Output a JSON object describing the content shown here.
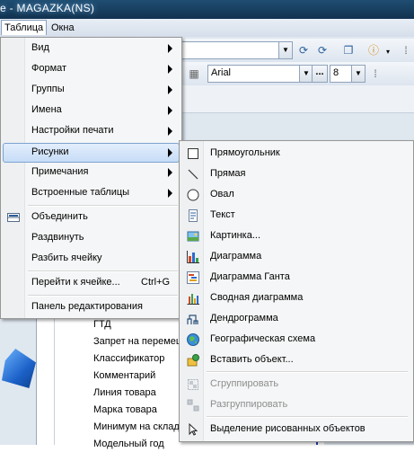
{
  "window": {
    "title": "e - MAGAZKA(NS)"
  },
  "menubar": {
    "items": [
      "Таблица",
      "Окна"
    ]
  },
  "toolbar": {
    "font_name": "Arial",
    "font_size": "8",
    "more_button": "..."
  },
  "document": {
    "header": "ГТД",
    "lines": [
      "Запрет на перемещ",
      "Классификатор",
      "Комментарий",
      "Линия товара",
      "Марка товара",
      "Минимум на складе",
      "Модельный год"
    ]
  },
  "table_menu": {
    "items": [
      {
        "label": "Вид",
        "submenu": true
      },
      {
        "label": "Формат",
        "submenu": true
      },
      {
        "label": "Группы",
        "submenu": true
      },
      {
        "label": "Имена",
        "submenu": true
      },
      {
        "label": "Настройки печати",
        "submenu": true
      },
      {
        "label": "Рисунки",
        "submenu": true,
        "highlighted": true
      },
      {
        "label": "Примечания",
        "submenu": true
      },
      {
        "label": "Встроенные таблицы",
        "submenu": true
      },
      {
        "label": "Объединить",
        "icon": "merge-cells-icon"
      },
      {
        "label": "Раздвинуть"
      },
      {
        "label": "Разбить ячейку"
      },
      {
        "label": "Перейти к ячейке...",
        "shortcut": "Ctrl+G"
      },
      {
        "label": "Панель редактирования"
      }
    ]
  },
  "pictures_submenu": {
    "items": [
      {
        "label": "Прямоугольник",
        "icon": "rectangle-icon"
      },
      {
        "label": "Прямая",
        "icon": "line-icon"
      },
      {
        "label": "Овал",
        "icon": "oval-icon"
      },
      {
        "label": "Текст",
        "icon": "text-icon"
      },
      {
        "label": "Картинка...",
        "icon": "picture-icon"
      },
      {
        "label": "Диаграмма",
        "icon": "chart-icon"
      },
      {
        "label": "Диаграмма Ганта",
        "icon": "gantt-chart-icon"
      },
      {
        "label": "Сводная диаграмма",
        "icon": "pivot-chart-icon"
      },
      {
        "label": "Дендрограмма",
        "icon": "dendrogram-icon"
      },
      {
        "label": "Географическая схема",
        "icon": "globe-icon"
      },
      {
        "label": "Вставить объект...",
        "icon": "insert-object-icon"
      },
      {
        "label": "Сгруппировать",
        "icon": "group-icon",
        "disabled": true
      },
      {
        "label": "Разгруппировать",
        "icon": "ungroup-icon",
        "disabled": true
      },
      {
        "label": "Выделение рисованных объектов",
        "icon": "pointer-icon"
      }
    ]
  },
  "colors": {
    "highlight": "#c6dcf7",
    "disabled_text": "#8d8d8d",
    "title_bar": "#1f4d72"
  }
}
